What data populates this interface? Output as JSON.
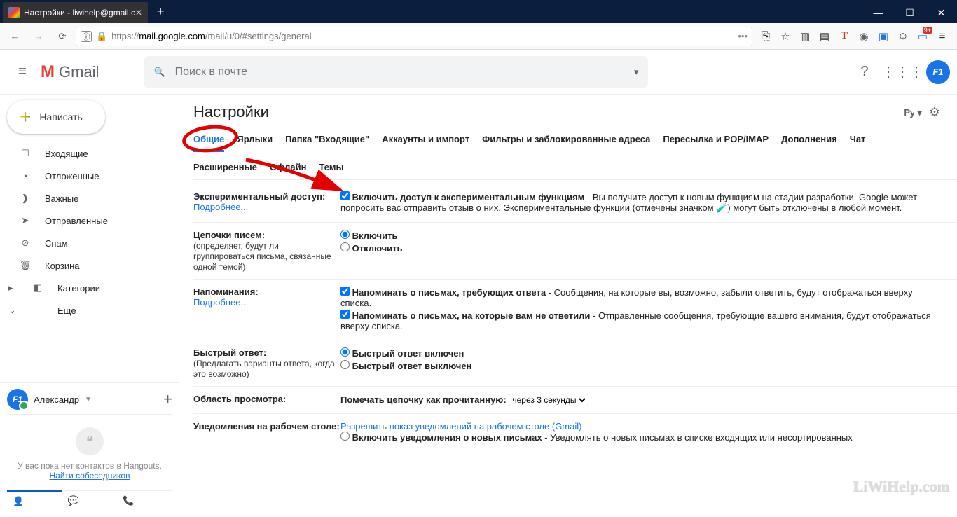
{
  "browser": {
    "tab_title": "Настройки - liwihelp@gmail.c",
    "url_prefix": "https://",
    "url_host": "mail.google.com",
    "url_path": "/mail/u/0/#settings/general"
  },
  "header": {
    "logo": "Gmail",
    "search_placeholder": "Поиск в почте"
  },
  "compose_label": "Написать",
  "sidebar": [
    {
      "icon": "☐",
      "label": "Входящие"
    },
    {
      "icon": "◔",
      "label": "Отложенные"
    },
    {
      "icon": "★",
      "label": "Важные"
    },
    {
      "icon": "▶",
      "label": "Отправленные"
    },
    {
      "icon": "⊘",
      "label": "Спам"
    },
    {
      "icon": "🗑",
      "label": "Корзина"
    },
    {
      "icon": "▸",
      "label": "Категории",
      "expandable": true
    },
    {
      "icon": "⌄",
      "label": "Ещё"
    }
  ],
  "hangouts": {
    "user": "Александр",
    "empty1": "У вас пока нет контактов в Hangouts.",
    "link": "Найти собеседников"
  },
  "settings": {
    "title": "Настройки",
    "lang": "Рꭚ",
    "tabs1": [
      "Общие",
      "Ярлыки",
      "Папка \"Входящие\"",
      "Аккаунты и импорт",
      "Фильтры и заблокированные адреса",
      "Пересылка и POP/IMAP",
      "Дополнения",
      "Чат"
    ],
    "tabs2": [
      "Расширенные",
      "Офлайн",
      "Темы"
    ],
    "rows": {
      "exp": {
        "label": "Экспериментальный доступ:",
        "more": "Подробнее...",
        "opt": "Включить доступ к экспериментальным функциям",
        "desc": " - Вы получите доступ к новым функциям на стадии разработки. Google может попросить вас отправить отзыв о них. Экспериментальные функции (отмечены значком 🧪) могут быть отключены в любой момент."
      },
      "conv": {
        "label": "Цепочки писем:",
        "sub": "(определяет, будут ли группироваться письма, связанные одной темой)",
        "on": "Включить",
        "off": "Отключить"
      },
      "nudges": {
        "label": "Напоминания:",
        "more": "Подробнее...",
        "o1b": "Напоминать о письмах, требующих ответа",
        "o1t": " - Сообщения, на которые вы, возможно, забыли ответить, будут отображаться вверху списка.",
        "o2b": "Напоминать о письмах, на которые вам не ответили",
        "o2t": " - Отправленные сообщения, требующие вашего внимания, будут отображаться вверху списка."
      },
      "smart": {
        "label": "Быстрый ответ:",
        "sub": "(Предлагать варианты ответа, когда это возможно)",
        "on": "Быстрый ответ включен",
        "off": "Быстрый ответ выключен"
      },
      "preview": {
        "label": "Область просмотра:",
        "text": "Помечать цепочку как прочитанную: ",
        "select": "через 3 секунды"
      },
      "notif": {
        "label": "Уведомления на рабочем столе:",
        "link": "Разрешить показ уведомлений на рабочем столе (Gmail)",
        "o1b": "Включить уведомления о новых письмах",
        "o1t": " - Уведомлять о новых письмах в списке входящих или несортированных"
      }
    }
  },
  "watermark": "LiWiHelp.com"
}
